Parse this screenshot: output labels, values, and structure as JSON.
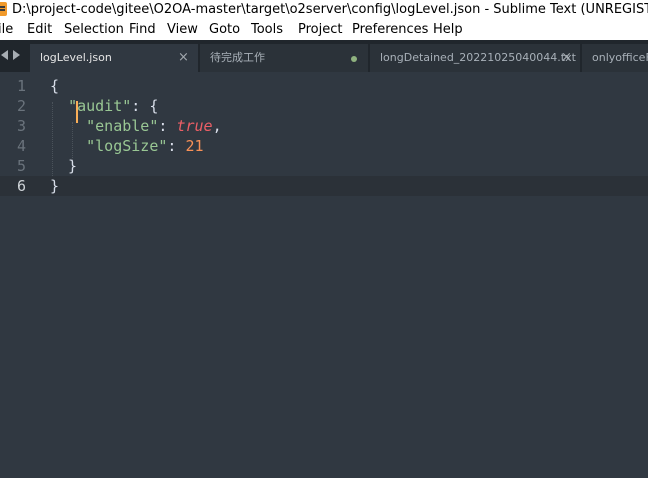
{
  "window": {
    "title": "D:\\project-code\\gitee\\O2OA-master\\target\\o2server\\config\\logLevel.json - Sublime Text (UNREGISTERED)"
  },
  "menu": [
    "ile",
    "Edit",
    "Selection",
    "Find",
    "View",
    "Goto",
    "Tools",
    "Project",
    "Preferences",
    "Help"
  ],
  "tabs": [
    {
      "label": "logLevel.json",
      "active": true,
      "close": "×"
    },
    {
      "label": "待完成工作",
      "active": false,
      "modified": true
    },
    {
      "label": "longDetained_20221025040044.txt",
      "active": false,
      "close": "×"
    },
    {
      "label": "onlyofficeFi",
      "active": false
    }
  ],
  "editor": {
    "line_numbers": [
      "1",
      "2",
      "3",
      "4",
      "5",
      "6"
    ],
    "lines": [
      [
        {
          "t": "{",
          "c": "punct"
        }
      ],
      [
        {
          "t": "  ",
          "c": "punct"
        },
        {
          "t": "\"audit\"",
          "c": "key"
        },
        {
          "t": ": {",
          "c": "punct"
        }
      ],
      [
        {
          "t": "    ",
          "c": "punct"
        },
        {
          "t": "\"enable\"",
          "c": "key"
        },
        {
          "t": ": ",
          "c": "punct"
        },
        {
          "t": "true",
          "c": "bool"
        },
        {
          "t": ",",
          "c": "punct"
        }
      ],
      [
        {
          "t": "    ",
          "c": "punct"
        },
        {
          "t": "\"logSize\"",
          "c": "key"
        },
        {
          "t": ": ",
          "c": "punct"
        },
        {
          "t": "21",
          "c": "num"
        }
      ],
      [
        {
          "t": "  }",
          "c": "punct"
        }
      ],
      [
        {
          "t": "}",
          "c": "punct"
        }
      ]
    ],
    "current_line": 6
  },
  "colors": {
    "background": "#303841",
    "key": "#99c794",
    "boolean": "#ec5f66",
    "number": "#f99157",
    "caret": "#f9ae58"
  }
}
